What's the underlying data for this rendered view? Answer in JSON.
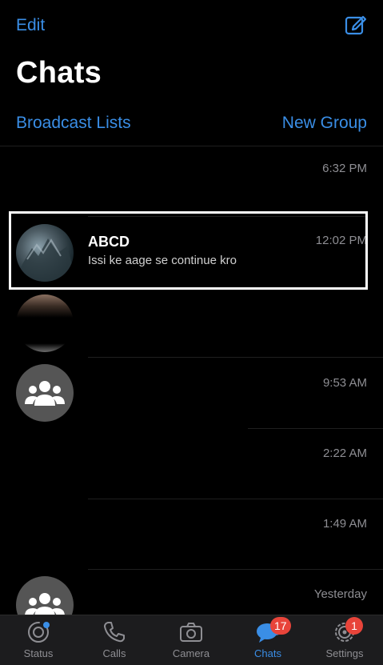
{
  "header": {
    "edit_label": "Edit",
    "compose_icon": "compose-icon",
    "title": "Chats"
  },
  "actions": {
    "broadcast_label": "Broadcast Lists",
    "new_group_label": "New Group"
  },
  "chats": [
    {
      "name": "",
      "preview": "",
      "time": "6:32 PM",
      "avatar": "none"
    },
    {
      "name": "ABCD",
      "preview": "Issi ke aage se continue kro",
      "time": "12:02 PM",
      "avatar": "photo"
    },
    {
      "name": "",
      "preview": "",
      "time": "",
      "avatar": "partial-photo"
    },
    {
      "name": "",
      "preview": "",
      "time": "9:53 AM",
      "avatar": "group"
    },
    {
      "name": "",
      "preview": "",
      "time": "2:22 AM",
      "avatar": "none"
    },
    {
      "name": "",
      "preview": "",
      "time": "1:49 AM",
      "avatar": "none"
    },
    {
      "name": "",
      "preview": "",
      "time": "Yesterday",
      "avatar": "group"
    }
  ],
  "tabbar": {
    "tabs": [
      {
        "label": "Status",
        "icon": "status-icon"
      },
      {
        "label": "Calls",
        "icon": "phone-icon"
      },
      {
        "label": "Camera",
        "icon": "camera-icon"
      },
      {
        "label": "Chats",
        "icon": "chats-icon",
        "badge": "17",
        "active": true
      },
      {
        "label": "Settings",
        "icon": "gear-icon",
        "badge": "1"
      }
    ]
  },
  "colors": {
    "accent": "#3a8ee6",
    "background": "#000000",
    "badge": "#e8443a"
  }
}
